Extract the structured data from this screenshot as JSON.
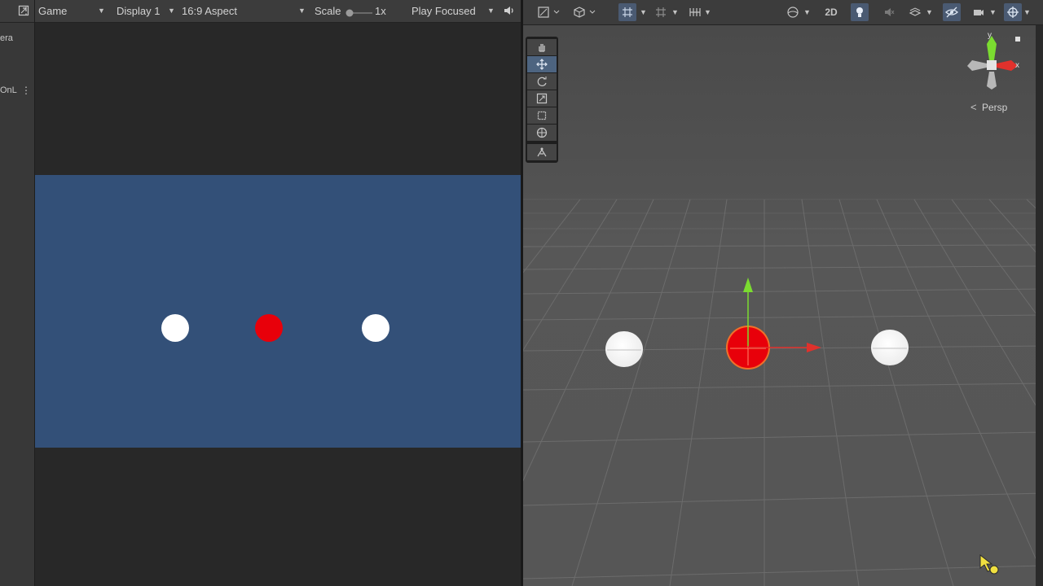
{
  "hierarchy": {
    "partial_top": "era",
    "partial_item": "OnL"
  },
  "game_toolbar": {
    "view_name": "Game",
    "display": "Display 1",
    "aspect": "16:9 Aspect",
    "scale_label": "Scale",
    "scale_value": "1x",
    "play_mode": "Play Focused"
  },
  "game_view": {
    "background_color": "#335078",
    "balls": [
      {
        "color": "#ffffff"
      },
      {
        "color": "#e8000a"
      },
      {
        "color": "#ffffff"
      }
    ]
  },
  "scene_toolbar": {
    "toggle_2d": "2D"
  },
  "scene_tools": [
    "hand-tool",
    "move-tool",
    "rotate-tool",
    "scale-tool",
    "rect-tool",
    "transform-tool",
    "custom-tool"
  ],
  "scene_gizmo": {
    "projection": "Persp",
    "x_label": "x",
    "y_label": "y"
  },
  "colors": {
    "accent_blue": "#4d6480",
    "axis_x": "#e0312c",
    "axis_y": "#7bdc30",
    "selected_sphere": "#e8000a"
  }
}
